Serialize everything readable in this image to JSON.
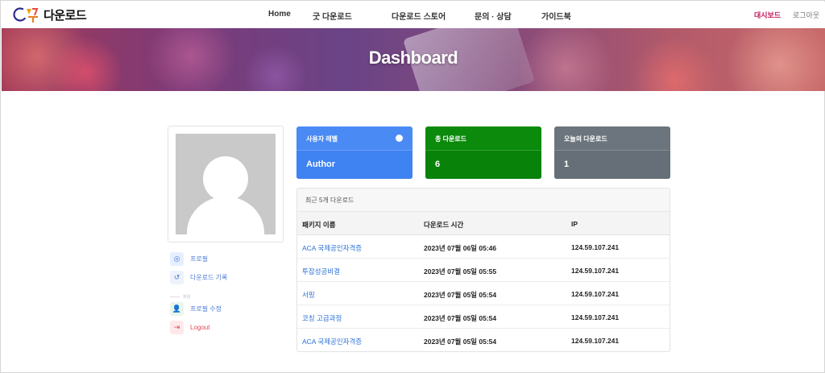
{
  "header": {
    "logo_text": "다운로드",
    "nav": [
      "Home",
      "굿 다운로드",
      "다운로드 스토어",
      "문의 · 상담",
      "가이드북"
    ],
    "dashboard_link": "대시보드",
    "logout_link": "로그아웃",
    "dashboard_color": "#c2185b"
  },
  "hero": {
    "title": "Dashboard"
  },
  "sidebar": {
    "items": [
      {
        "label": "프로필",
        "icon": "user-circle-icon"
      },
      {
        "label": "다운로드 기록",
        "icon": "history-icon"
      },
      {
        "label": "프로필 수정",
        "icon": "user-edit-icon"
      },
      {
        "label": "Logout",
        "icon": "logout-icon"
      }
    ],
    "divider_label": "회원"
  },
  "stats": [
    {
      "title": "사용자 레벨",
      "value": "Author",
      "color": "#4a8af4"
    },
    {
      "title": "총 다운로드",
      "value": "6",
      "color": "#0b8a0b"
    },
    {
      "title": "오늘의 다운로드",
      "value": "1",
      "color": "#6c757d"
    }
  ],
  "recent": {
    "title": "최근 5개 다운로드",
    "columns": [
      "패키지 이름",
      "다운로드 시간",
      "IP"
    ],
    "rows": [
      {
        "package": "ACA 국제공인자격증",
        "time": "2023년 07월 06일 05:46",
        "ip": "124.59.107.241"
      },
      {
        "package": "투잡성공비결",
        "time": "2023년 07월 05일 05:55",
        "ip": "124.59.107.241"
      },
      {
        "package": "서핑",
        "time": "2023년 07월 05일 05:54",
        "ip": "124.59.107.241"
      },
      {
        "package": "코칭 고급과정",
        "time": "2023년 07월 05일 05:54",
        "ip": "124.59.107.241"
      },
      {
        "package": "ACA 국제공인자격증",
        "time": "2023년 07월 05일 05:54",
        "ip": "124.59.107.241"
      }
    ]
  }
}
